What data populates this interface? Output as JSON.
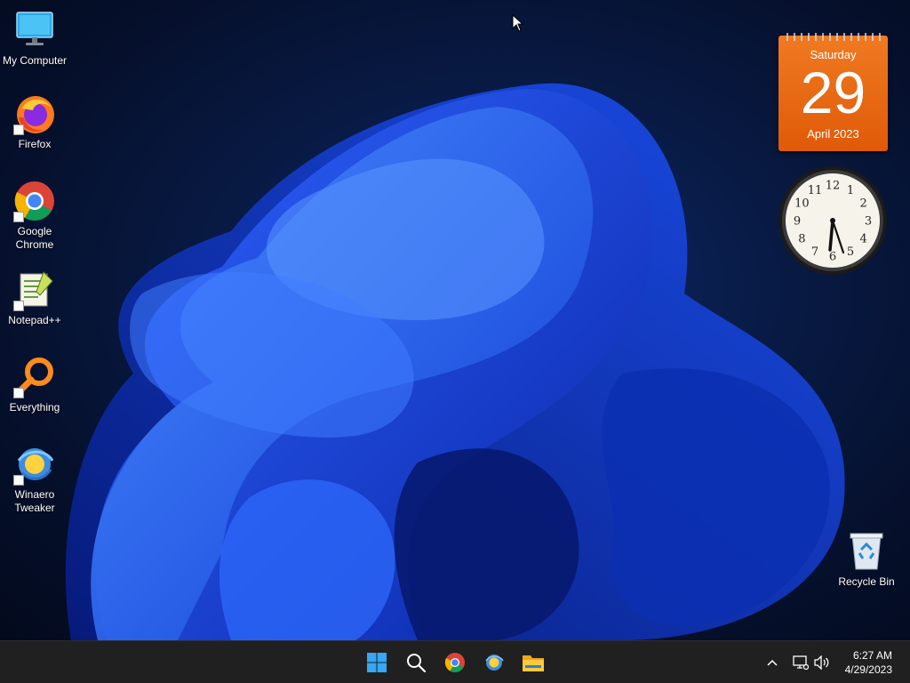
{
  "desktop": {
    "icons": [
      {
        "label": "My Computer"
      },
      {
        "label": "Firefox"
      },
      {
        "label": "Google Chrome"
      },
      {
        "label": "Notepad++"
      },
      {
        "label": "Everything"
      },
      {
        "label": "Winaero Tweaker"
      },
      {
        "label": "Recycle Bin"
      }
    ]
  },
  "gadgets": {
    "calendar": {
      "weekday": "Saturday",
      "day": "29",
      "month_year": "April 2023"
    },
    "clock": {
      "numerals": [
        "12",
        "1",
        "2",
        "3",
        "4",
        "5",
        "6",
        "7",
        "8",
        "9",
        "10",
        "11"
      ],
      "time": "6:27"
    }
  },
  "taskbar": {
    "apps": [
      {
        "name": "start",
        "icon": "windows-logo-icon"
      },
      {
        "name": "search",
        "icon": "search-icon"
      },
      {
        "name": "chrome",
        "icon": "chrome-icon"
      },
      {
        "name": "winaero-tweaker",
        "icon": "winaero-tweaker-icon"
      },
      {
        "name": "file-explorer",
        "icon": "folder-icon"
      }
    ],
    "tray": {
      "time": "6:27 AM",
      "date": "4/29/2023"
    }
  },
  "colors": {
    "accent": "#1f6fff",
    "taskbar": "#202020",
    "calendar": "#e8680f"
  }
}
